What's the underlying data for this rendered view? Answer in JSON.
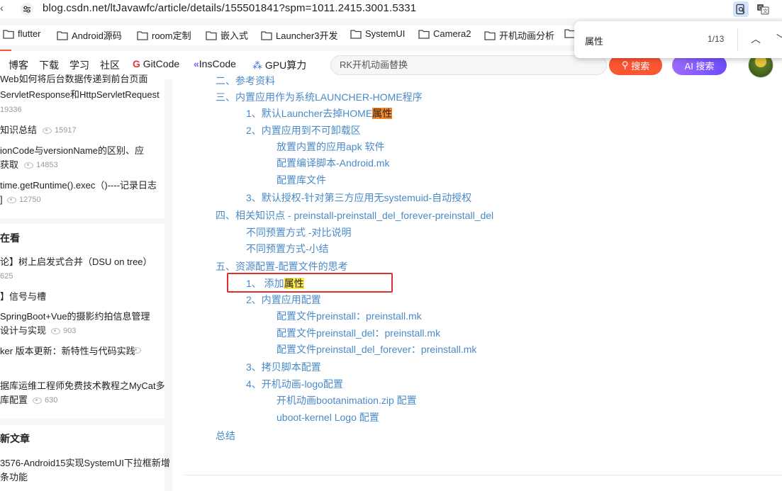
{
  "browser": {
    "url": "blog.csdn.net/ltJavawfc/article/details/155501841?spm=1011.2415.3001.5331",
    "bookmarks": [
      "flutter",
      "Android源码",
      "room定制",
      "嵌入式",
      "Launcher3开发",
      "SystemUI",
      "Camera2",
      "开机动画分析"
    ]
  },
  "find": {
    "query": "属性",
    "count": "1/13"
  },
  "nav": {
    "links": [
      "博客",
      "下载",
      "学习",
      "社区",
      "GitCode",
      "InsCode",
      "GPU算力"
    ],
    "search_placeholder": "RK开机动画替换",
    "search_btn": "搜索",
    "ai_btn": "AI 搜索"
  },
  "sidebar": {
    "popular": [
      {
        "l1": "Web如何将后台数据传递到前台页面",
        "l2": "ServletResponse和HttpServletRequest",
        "views": "19336"
      },
      {
        "l1": "知识总结",
        "views": "15917"
      },
      {
        "l1": "ionCode与versionName的区别、应",
        "l2": "获取",
        "views": "14853"
      },
      {
        "l1": "time.getRuntime().exec（)----记录日志",
        "l2": "]",
        "views": "12750"
      }
    ],
    "reading_title": "在看",
    "reading": [
      {
        "l1": "论】树上启发式合并（DSU on tree）",
        "views": "625"
      },
      {
        "l1": "】信号与槽"
      },
      {
        "l1": "SpringBoot+Vue的摄影约拍信息管理",
        "l2": "设计与实现",
        "views": "903"
      },
      {
        "l1": "ker 版本更新：新特性与代码实践"
      },
      {
        "l1": "据库运维工程师免费技术教程之MyCat多",
        "l2": "库配置",
        "views": "630"
      }
    ],
    "latest_title": "新文章",
    "latest": [
      {
        "l1": "3576-Android15实现SystemUI下拉框新增",
        "l2": "条功能"
      }
    ]
  },
  "toc": {
    "t0": "二、参考资料",
    "t1": "三、内置应用作为系统LAUNCHER-HOME程序",
    "t2a": "1、默认Launcher去掉HOME",
    "t2b": "属性",
    "t3": "2、内置应用到不可卸载区",
    "t4": "放置内置的应用apk 软件",
    "t5": "配置编译脚本-Android.mk",
    "t6": "配置库文件",
    "t7": "3、默认授权-针对第三方应用无systemuid-自动授权",
    "t8": "四、相关知识点 - preinstall-preinstall_del_forever-preinstall_del",
    "t9": "不同预置方式 -对比说明",
    "t10": "不同预置方式-小结",
    "t11": "五、资源配置-配置文件的思考",
    "t12a": "1、 添加",
    "t12b": "属性",
    "t13": "2、内置应用配置",
    "t14": "配置文件preinstall：preinstall.mk",
    "t15": "配置文件preinstall_del：preinstall.mk",
    "t16": "配置文件preinstall_del_forever：preinstall.mk",
    "t17": "3、拷贝脚本配置",
    "t18": "4、开机动画-logo配置",
    "t19": "开机动画bootanimation.zip 配置",
    "t20": "uboot-kernel Logo 配置",
    "t21": "总结"
  }
}
